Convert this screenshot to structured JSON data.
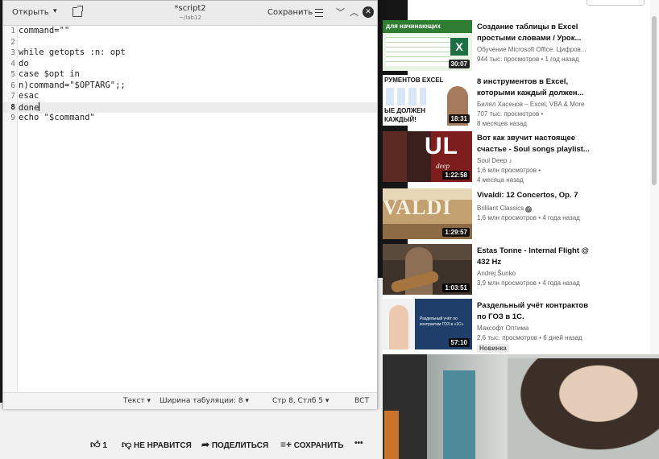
{
  "editor": {
    "open_label": "Открыть",
    "title": "*script2",
    "path": "~/lab12",
    "save_label": "Сохранить",
    "lines": [
      {
        "num": "1",
        "text": "command=\"\""
      },
      {
        "num": "2",
        "text": ""
      },
      {
        "num": "3",
        "text": "while getopts :n: opt"
      },
      {
        "num": "4",
        "text": "do"
      },
      {
        "num": "5",
        "text": "case $opt in"
      },
      {
        "num": "6",
        "text": "n)command=\"$OPTARG\";;"
      },
      {
        "num": "7",
        "text": "esac"
      },
      {
        "num": "8",
        "text": "done"
      },
      {
        "num": "9",
        "text": "echo \"$command\""
      }
    ],
    "current_line": 8,
    "status": {
      "syntax": "Текст",
      "tab_width": "Ширина табуляции: 8",
      "position": "Стр 8, Стлб 5",
      "mode": "ВСТ"
    }
  },
  "sidebar": {
    "videos": [
      {
        "title_line1": "Создание таблицы в Excel",
        "title_line2": "простыми словами / Урок...",
        "channel": "Обучение Microsoft Office. Цифров...",
        "meta": "944 тыс. просмотров • 1 год назад",
        "duration": "30:07",
        "thumb_text": "для начинающих"
      },
      {
        "title_line1": "8 инструментов в Excel,",
        "title_line2": "которыми каждый должен...",
        "channel": "Билял Хасенов – Excel, VBA & More",
        "meta": "707 тыс. просмотров •",
        "meta2": "8 месяцев назад",
        "duration": "18:31",
        "thumb_text": "РУМЕНТОВ EXCEL",
        "thumb_text2": "ЫЕ ДОЛЖЕН",
        "thumb_text3": "КАЖДЫЙ!"
      },
      {
        "title_line1": "Вот как звучит настоящее",
        "title_line2": "счастье - Soul songs playlist...",
        "channel": "Soul Deep",
        "meta": "1,6 млн просмотров •",
        "meta2": "4 месяца назад",
        "duration": "1:22:58",
        "thumb_text": "UL",
        "thumb_text2": "deep"
      },
      {
        "title_line1": "Vivaldi: 12 Concertos, Op. 7",
        "title_line2": "",
        "channel": "Brilliant Classics",
        "meta": "1,6 млн просмотров • 4 года назад",
        "duration": "1:29:57",
        "thumb_text": "VALDI"
      },
      {
        "title_line1": "Estas Tonne - Internal Flight @",
        "title_line2": "432 Hz",
        "channel": "Andrej Šunko",
        "meta": "3,9 млн просмотров • 4 года назад",
        "duration": "1:03:51"
      },
      {
        "title_line1": "Раздельный учёт контрактов",
        "title_line2": "по ГОЗ в 1С.",
        "channel": "Максофт Оптима",
        "meta": "2,6 тыс. просмотров • 6 дней назад",
        "badge": "Новинка",
        "duration": "57:10",
        "thumb_text": "Раздельный учёт по контрактам ГОЗ в «1С»"
      }
    ]
  },
  "actions": {
    "like_count": "1",
    "dislike_label": "НЕ НРАВИТСЯ",
    "share_label": "ПОДЕЛИТЬСЯ",
    "save_label": "СОХРАНИТЬ",
    "more_label": "•••"
  },
  "colors": {
    "editor_bg": "#ffffff",
    "titlebar": "#ebebeb",
    "current_line": "#ececec",
    "yt_text": "#0f0f0f",
    "yt_meta": "#606060"
  }
}
